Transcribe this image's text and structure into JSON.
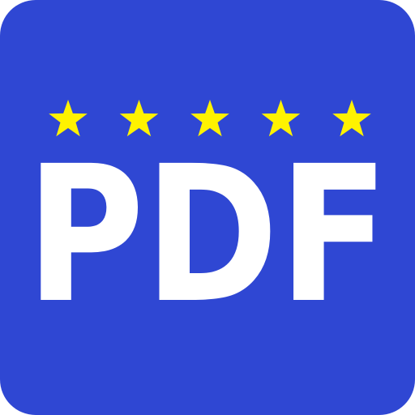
{
  "icon": {
    "text": "PDF",
    "star_count": 5,
    "colors": {
      "background": "#2F47D3",
      "text": "#FFFFFF",
      "stars": "#FFF200"
    },
    "icons": [
      "star-icon"
    ]
  }
}
